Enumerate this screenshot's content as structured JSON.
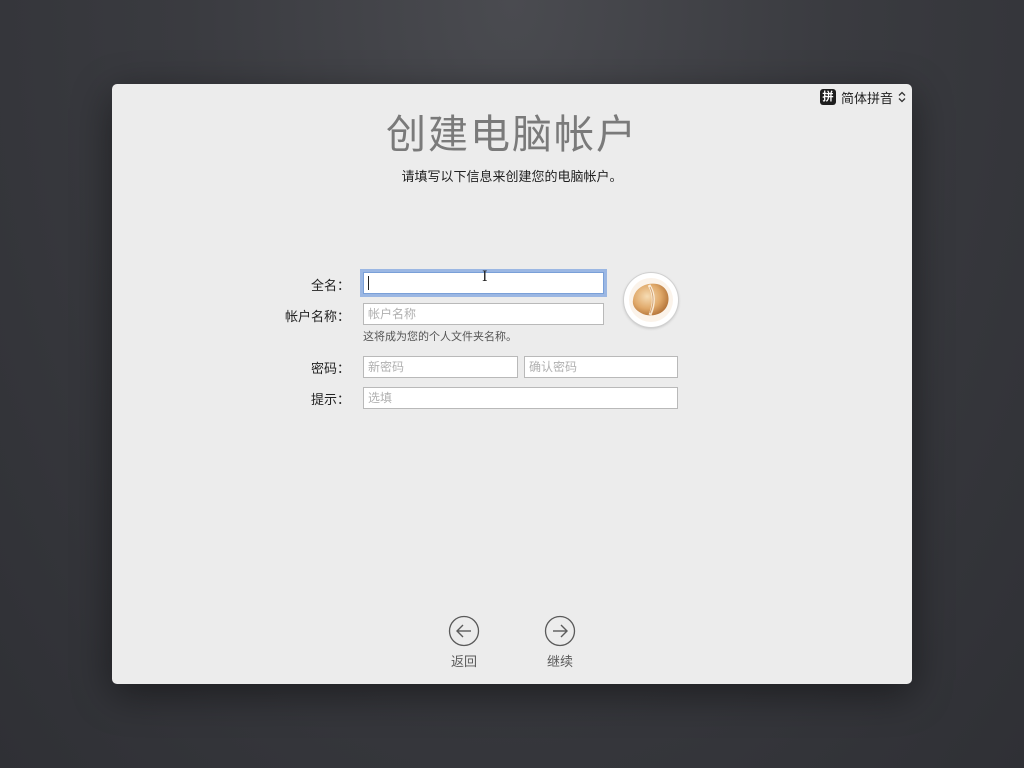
{
  "input_source": {
    "badge": "拼",
    "label": "简体拼音"
  },
  "title": "创建电脑帐户",
  "subtitle": "请填写以下信息来创建您的电脑帐户。",
  "form": {
    "fullname_label": "全名：",
    "fullname_value": "",
    "account_label": "帐户名称：",
    "account_placeholder": "帐户名称",
    "account_hint": "这将成为您的个人文件夹名称。",
    "password_label": "密码：",
    "password_placeholder": "新密码",
    "confirm_placeholder": "确认密码",
    "hint_label": "提示：",
    "hint_placeholder": "选填"
  },
  "nav": {
    "back_label": "返回",
    "continue_label": "继续"
  },
  "colors": {
    "focus_ring": "#5a8cdc",
    "window_bg": "#ececec",
    "desktop_bg": "#3a3b40"
  },
  "icons": [
    "fortune-cookie-avatar",
    "back-arrow-icon",
    "forward-arrow-icon",
    "chevron-updown-icon"
  ]
}
